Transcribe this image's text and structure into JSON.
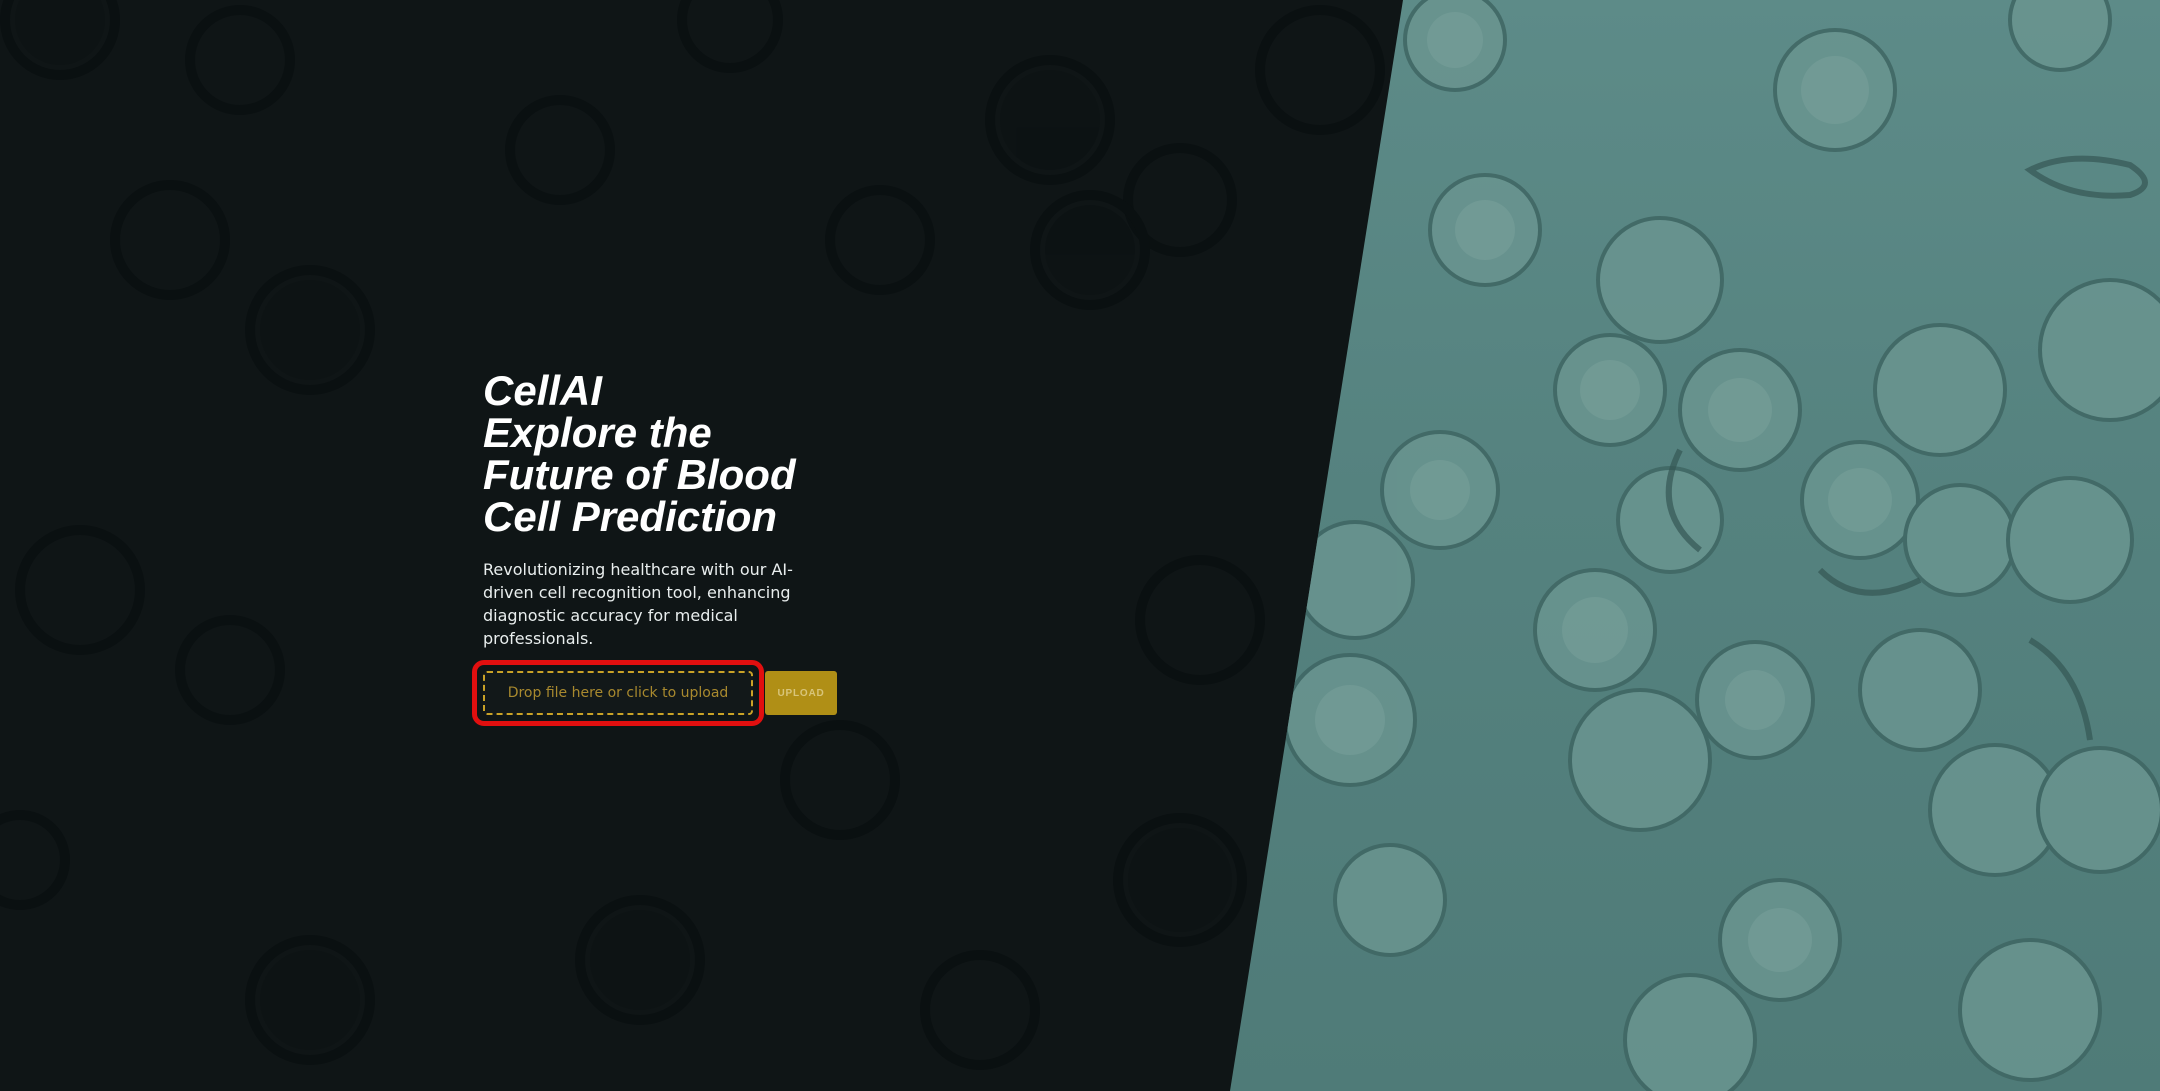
{
  "hero": {
    "title_lines": [
      "CellAI",
      "Explore the",
      "Future of Blood",
      "Cell Prediction"
    ],
    "subtitle": "Revolutionizing healthcare with our AI-driven cell recognition tool, enhancing diagnostic accuracy for medical professionals."
  },
  "upload": {
    "drop_zone_text": "Drop file here or click to upload",
    "button_label": "UPLOAD"
  },
  "colors": {
    "background": "#0f1516",
    "panel": "#55827f",
    "accent": "#b08f16",
    "highlight": "#e10f0f"
  },
  "icons": {
    "background_art": "blood-cells-microscope-image"
  }
}
